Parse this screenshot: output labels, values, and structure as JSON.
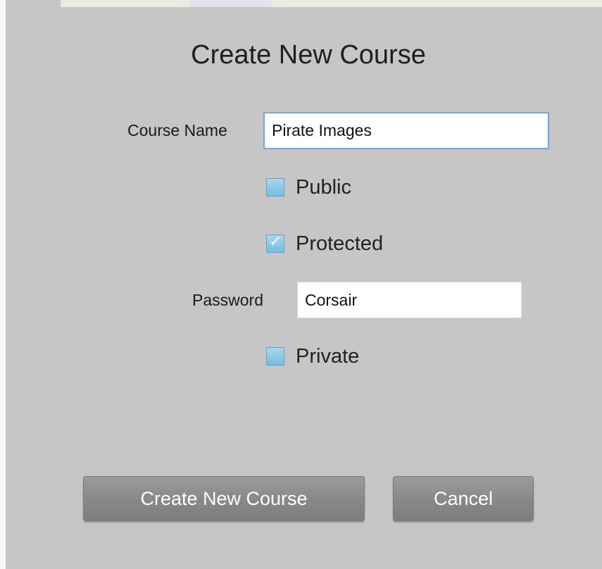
{
  "dialog": {
    "title": "Create New Course"
  },
  "form": {
    "course_name_label": "Course Name",
    "course_name_value": "Pirate Images",
    "options": [
      {
        "label": "Public",
        "checked": false
      },
      {
        "label": "Protected",
        "checked": true
      },
      {
        "label": "Private",
        "checked": false
      }
    ],
    "password_label": "Password",
    "password_value": "Corsair"
  },
  "buttons": {
    "create_label": "Create New Course",
    "cancel_label": "Cancel"
  },
  "colors": {
    "dialog_background": "#c6c6c6",
    "checkbox_fill": "#8ccbe8",
    "button_gray": "#8a8a8a",
    "focus_border": "#7fa8cf"
  }
}
